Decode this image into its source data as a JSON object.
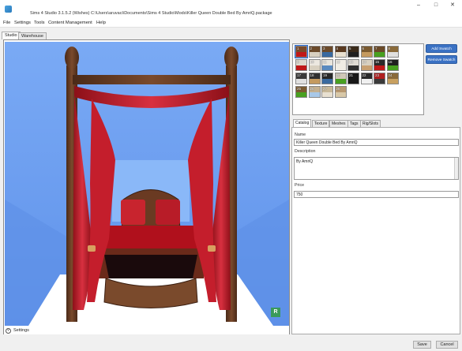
{
  "window": {
    "title": "Sims 4 Studio 3.1.5.2 (Wishes)  C:\\Users\\aruvaci\\Documents\\Sims 4 Studio\\Mods\\Killer Queen Double Bed By AmriQ.package",
    "minimize": "–",
    "maximize": "□",
    "close": "✕"
  },
  "menu": [
    "File",
    "Settings",
    "Tools",
    "Content Management",
    "Help"
  ],
  "top_tabs": [
    "Studio",
    "Warehouse"
  ],
  "settings_label": "Settings",
  "watermark": "R",
  "swatch_buttons": {
    "add": "Add Swatch",
    "remove": "Remove Swatch"
  },
  "swatches": [
    {
      "n": "1",
      "top": "#7a4a2a",
      "bot": "#c01818",
      "selected": true
    },
    {
      "n": "2",
      "top": "#6b4a2a",
      "bot": "#d8d0c0"
    },
    {
      "n": "3",
      "top": "#6b4a2a",
      "bot": "#3a6aa0"
    },
    {
      "n": "4",
      "top": "#5a3a20",
      "bot": "#e8e0d0"
    },
    {
      "n": "5",
      "top": "#3a2a1a",
      "bot": "#202020"
    },
    {
      "n": "6",
      "top": "#7a5a30",
      "bot": "#c49a60"
    },
    {
      "n": "7",
      "top": "#6a4a28",
      "bot": "#48a020"
    },
    {
      "n": "8",
      "top": "#8a6a3a",
      "bot": "#e0e0e0"
    },
    {
      "n": "9",
      "top": "#ddd8cc",
      "bot": "#c01818"
    },
    {
      "n": "10",
      "top": "#ece8e0",
      "bot": "#d8d0c0"
    },
    {
      "n": "11",
      "top": "#e8e4dc",
      "bot": "#5a8ac0"
    },
    {
      "n": "12",
      "top": "#f0ece4",
      "bot": "#f0ece4"
    },
    {
      "n": "13",
      "top": "#e0dcd4",
      "bot": "#303030"
    },
    {
      "n": "14",
      "top": "#d8d0c0",
      "bot": "#c8a070"
    },
    {
      "n": "15",
      "top": "#2a2a2a",
      "bot": "#c01818"
    },
    {
      "n": "16",
      "top": "#202020",
      "bot": "#48a020"
    },
    {
      "n": "17",
      "top": "#3a3a3a",
      "bot": "#e0e0e0"
    },
    {
      "n": "18",
      "top": "#303030",
      "bot": "#c49a60"
    },
    {
      "n": "19",
      "top": "#282828",
      "bot": "#3a6aa0"
    },
    {
      "n": "20",
      "top": "#d0c8b8",
      "bot": "#48a020"
    },
    {
      "n": "21",
      "top": "#181818",
      "bot": "#181818"
    },
    {
      "n": "22",
      "top": "#2a2a2a",
      "bot": "#f0f0f0"
    },
    {
      "n": "23",
      "top": "#b02020",
      "bot": "#3a3a3a"
    },
    {
      "n": "24",
      "top": "#8a6a3a",
      "bot": "#c8a060"
    },
    {
      "n": "25",
      "top": "#7a5a30",
      "bot": "#48a020"
    },
    {
      "n": "26",
      "top": "#c4b090",
      "bot": "#a8c8e8"
    },
    {
      "n": "27",
      "top": "#c8b898",
      "bot": "#e8e0d0"
    },
    {
      "n": "28",
      "top": "#b89870",
      "bot": "#d8c8a8"
    }
  ],
  "props_tabs": [
    "Catalog",
    "Texture",
    "Meshes",
    "Tags",
    "Rig/Slots"
  ],
  "fields": {
    "name_label": "Name",
    "name_value": "Killer Queen Double Bed By AmriQ",
    "description_label": "Description",
    "description_value": "By AmriQ",
    "price_label": "Price",
    "price_value": "750"
  },
  "bottom": {
    "save": "Save",
    "cancel": "Cancel"
  }
}
